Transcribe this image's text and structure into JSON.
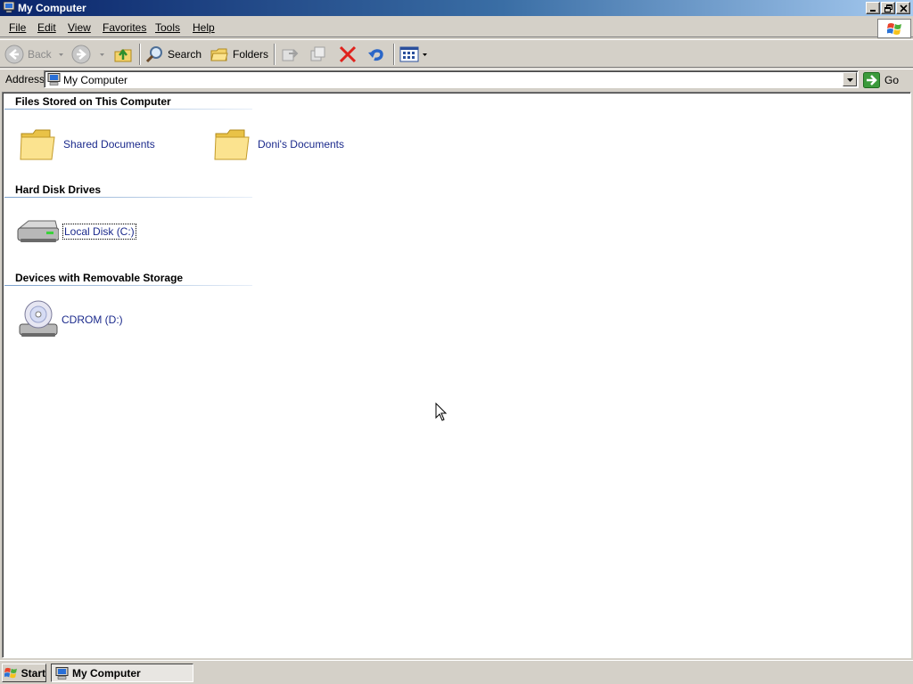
{
  "window": {
    "title": "My Computer"
  },
  "menubar": {
    "items": [
      {
        "label": "File",
        "hotkey": "F"
      },
      {
        "label": "Edit",
        "hotkey": "E"
      },
      {
        "label": "View",
        "hotkey": "V"
      },
      {
        "label": "Favorites",
        "hotkey": "a"
      },
      {
        "label": "Tools",
        "hotkey": "T"
      },
      {
        "label": "Help",
        "hotkey": "H"
      }
    ]
  },
  "toolbar": {
    "back_label": "Back",
    "search_label": "Search",
    "folders_label": "Folders",
    "icons": [
      "back-icon",
      "forward-icon",
      "up-folder-icon",
      "search-icon",
      "folders-icon",
      "move-to-icon",
      "copy-to-icon",
      "delete-icon",
      "undo-icon",
      "views-icon"
    ]
  },
  "address": {
    "label": "Address",
    "value": "My Computer",
    "go_label": "Go"
  },
  "content": {
    "groups": [
      {
        "title": "Files Stored on This Computer",
        "items": [
          {
            "label": "Shared Documents",
            "icon": "folder-icon"
          },
          {
            "label": "Doni's Documents",
            "icon": "folder-icon"
          }
        ]
      },
      {
        "title": "Hard Disk Drives",
        "items": [
          {
            "label": "Local Disk (C:)",
            "icon": "hard-disk-icon",
            "selected": true
          }
        ]
      },
      {
        "title": "Devices with Removable Storage",
        "items": [
          {
            "label": "CDROM (D:)",
            "icon": "cdrom-icon"
          }
        ]
      }
    ]
  },
  "taskbar": {
    "start_label": "Start",
    "task_label": "My Computer"
  },
  "colors": {
    "titlebar_start": "#0a246a",
    "titlebar_end": "#a6caf0",
    "face": "#d4d0c8",
    "link_text": "#1b2a8c"
  }
}
